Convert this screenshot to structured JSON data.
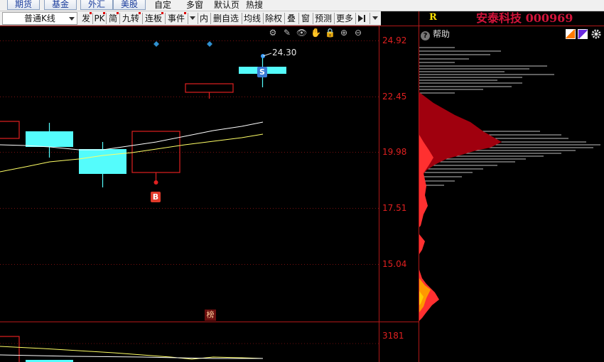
{
  "top_tabs": [
    "期货",
    "基金",
    "外汇",
    "美股"
  ],
  "top_links": [
    "自定",
    "多窗",
    "默认页",
    "热搜"
  ],
  "toolbar": {
    "kline_type": "普通K线",
    "buttons": [
      "发",
      "PK",
      "简",
      "九转",
      "连板",
      "事件",
      "内",
      "删自选",
      "均线",
      "除权",
      "叠",
      "窗",
      "预测",
      "更多"
    ]
  },
  "stock": {
    "market": "R",
    "name": "安泰科技",
    "code": "000969"
  },
  "help_label": "帮助",
  "price_axis": [
    "24.92",
    "22.45",
    "19.98",
    "17.51",
    "15.04"
  ],
  "volume_axis": "3181",
  "latest_high": "24.30",
  "markers": {
    "buy": "B",
    "sell": "S",
    "hot": "榜"
  },
  "colors": {
    "up": "#e02020",
    "down": "#54fcfc",
    "ma5": "#ffffff",
    "ma10": "#ffff66",
    "chip_main": "#a0000e",
    "chip_bright": "#ff3030",
    "chip_low": "#ff9900"
  }
}
